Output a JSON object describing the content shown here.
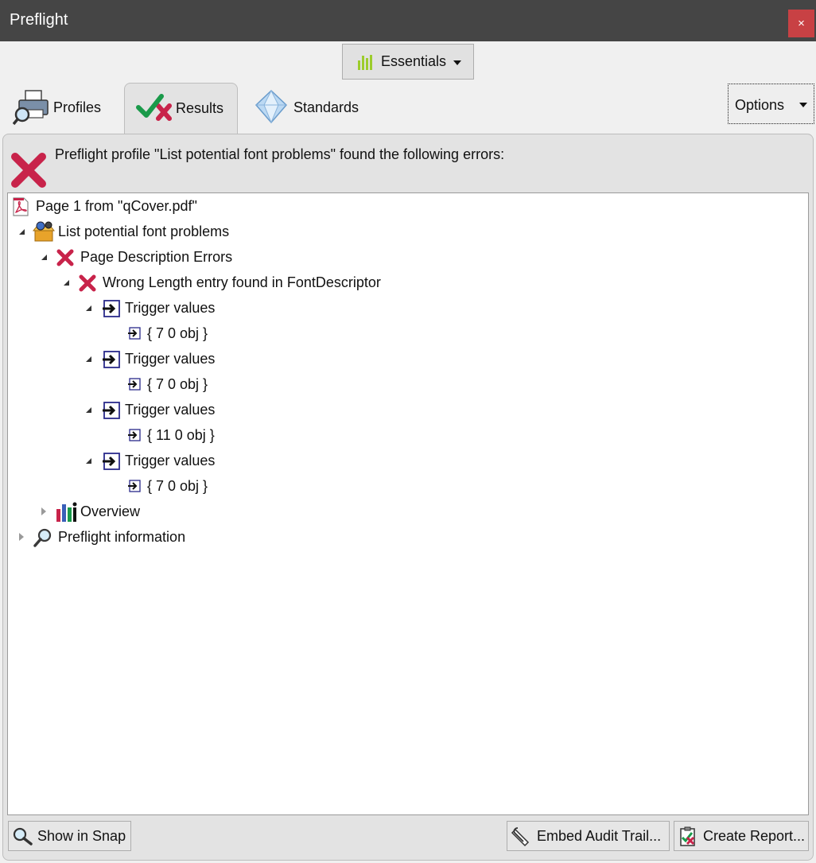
{
  "window": {
    "title": "Preflight",
    "close_glyph": "×"
  },
  "toolbar": {
    "profile_set_label": "Essentials",
    "profile_set_icon": "bar-chart-icon"
  },
  "tabs": [
    {
      "label": "Profiles",
      "icon": "printer-magnifier-icon",
      "active": false
    },
    {
      "label": "Results",
      "icon": "check-cross-icon",
      "active": true
    },
    {
      "label": "Standards",
      "icon": "diamond-icon",
      "active": false
    }
  ],
  "options": {
    "label": "Options"
  },
  "summary": {
    "text": "Preflight profile \"List potential font problems\" found the following errors:",
    "icon": "error-x-icon"
  },
  "tree": {
    "page_node": "Page 1 from \"qCover.pdf\"",
    "profile_node": "List potential font problems",
    "category_node": "Page Description Errors",
    "rule_node": "Wrong Length entry found in FontDescriptor",
    "trigger_label": "Trigger values",
    "trigger_values": [
      "{ 7 0 obj }",
      "{ 7 0 obj }",
      "{ 11 0 obj }",
      "{ 7 0 obj }"
    ],
    "overview_node": "Overview",
    "info_node": "Preflight information"
  },
  "buttons": {
    "show_in_snap": "Show in Snap",
    "embed_audit_trail": "Embed Audit Trail...",
    "create_report": "Create Report..."
  },
  "colors": {
    "titlebar": "#454545",
    "close": "#c84144",
    "error": "#c8234a",
    "check": "#1a9a4a",
    "tree_bg": "#ffffff",
    "panel": "#e3e3e3"
  }
}
